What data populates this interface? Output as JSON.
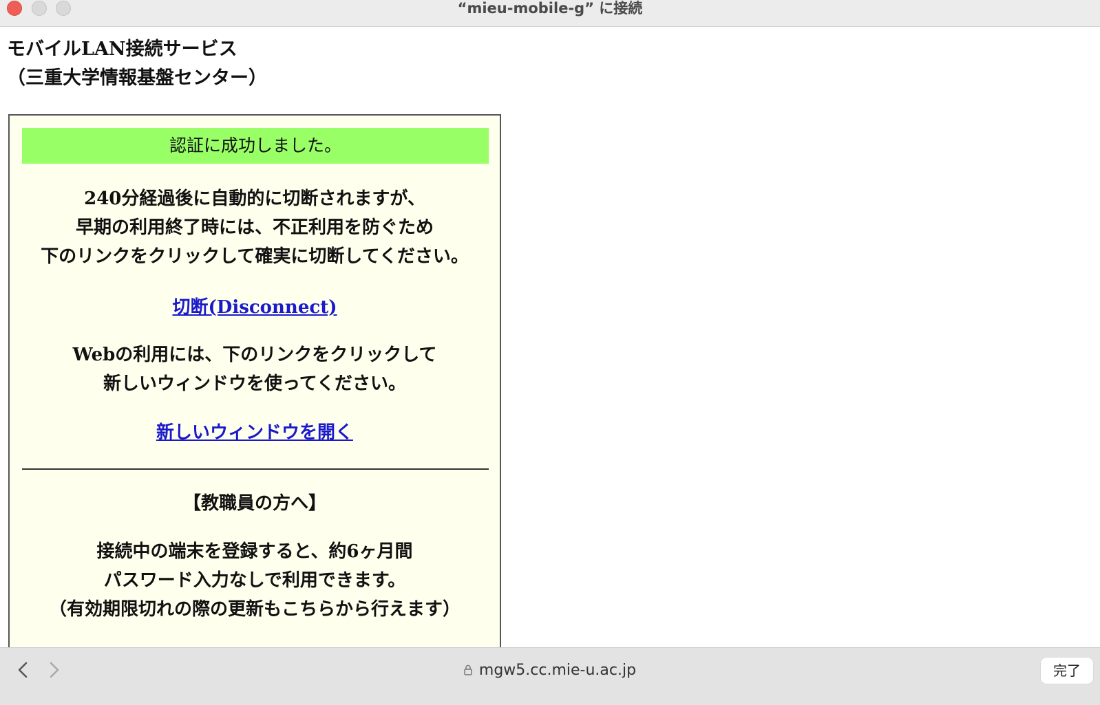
{
  "window": {
    "title": "“mieu-mobile-g” に接続"
  },
  "page": {
    "site_title_line1": "モバイルLAN接続サービス",
    "site_title_line2": "（三重大学情報基盤センター）",
    "banner": "認証に成功しました。",
    "notice_lines": [
      "240分経過後に自動的に切断されますが、",
      "早期の利用終了時には、不正利用を防ぐため",
      "下のリンクをクリックして確実に切断してください。"
    ],
    "disconnect_link": "切断(Disconnect)",
    "web_lines": [
      "Webの利用には、下のリンクをクリックして",
      "新しいウィンドウを使ってください。"
    ],
    "new_window_link": "新しいウィンドウを開く",
    "staff_heading": "【教職員の方へ】",
    "staff_lines": [
      "接続中の端末を登録すると、約6ヶ月間",
      "パスワード入力なしで利用できます。",
      "（有効期限切れの際の更新もこちらから行えます）"
    ]
  },
  "toolbar": {
    "back_icon": "chevron-left-icon",
    "forward_icon": "chevron-right-icon",
    "lock_icon": "lock-icon",
    "url": "mgw5.cc.mie-u.ac.jp",
    "done_label": "完了"
  },
  "colors": {
    "banner_bg": "#99ff66",
    "panel_bg": "#ffffee",
    "link": "#1a1acc",
    "close_button": "#ee5e57"
  }
}
